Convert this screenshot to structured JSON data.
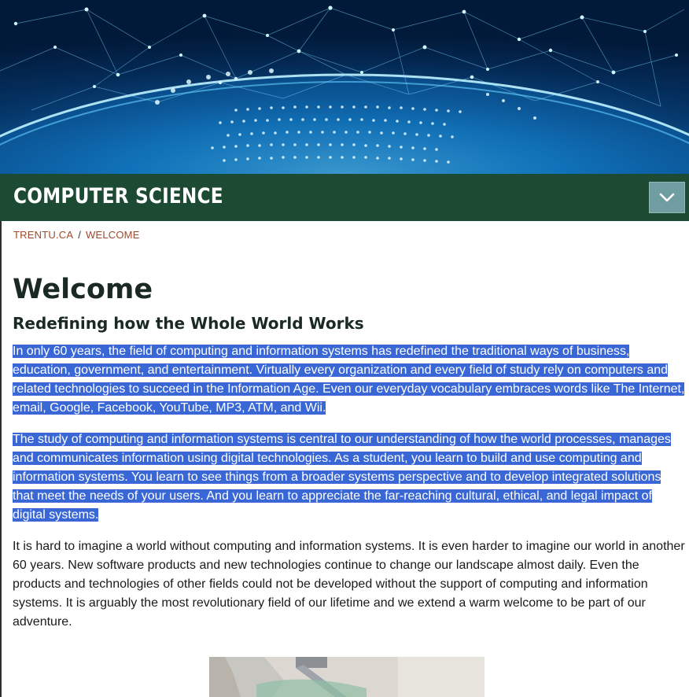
{
  "header": {
    "site_title": "COMPUTER SCIENCE",
    "menu_icon": "chevron-down-icon",
    "bar_color": "#1c4a32",
    "toggle_color": "#6f9da2"
  },
  "breadcrumb": {
    "home": "TRENTU.CA",
    "separator": "/",
    "current": "WELCOME",
    "link_color": "#a04a2a"
  },
  "main": {
    "title": "Welcome",
    "subtitle": "Redefining how the Whole World Works",
    "paragraphs": [
      "In only 60 years, the field of computing and information systems has redefined the traditional ways of business, education, government, and entertainment.  Virtually every organization and every field of study rely on computers and related technologies to succeed in the Information Age.  Even our everyday vocabulary embraces words like The Internet, email, Google, Facebook, YouTube, MP3, ATM, and Wii.",
      "The study of computing and information systems is central to our understanding of how the world processes, manages and communicates information using digital technologies.  As a student, you learn to build and use computing and information systems.  You learn to see things from a broader systems perspective and to develop integrated solutions that meet the needs of your users.  And you learn to appreciate the far-reaching cultural, ethical, and legal impact of digital systems.",
      "It is hard to imagine a world without computing and information systems.  It is even harder to imagine our world in another 60 years.  New software products and new technologies continue to change our landscape almost daily.  Even the products and technologies of other fields could not be developed without the support of computing and information systems.  It is arguably the most revolutionary field of our lifetime and we extend a warm welcome to be part of our adventure."
    ],
    "selection_color": "#3a67d6"
  }
}
